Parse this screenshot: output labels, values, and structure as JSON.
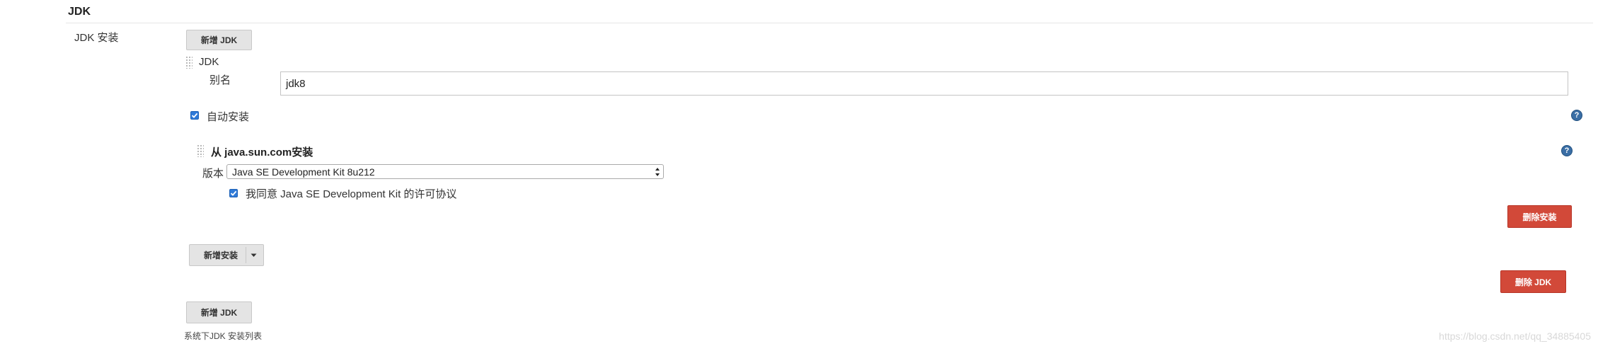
{
  "section": {
    "title": "JDK"
  },
  "jdk_install": {
    "label": "JDK 安装",
    "add_jdk_label": "新增 JDK",
    "entry": {
      "header": "JDK",
      "alias_label": "别名",
      "alias_value": "jdk8",
      "auto_install_label": "自动安装",
      "auto_install_checked": true,
      "installer": {
        "header": "从 java.sun.com安装",
        "version_label": "版本",
        "version_selected": "Java SE Development Kit 8u212",
        "license_label": "我同意 Java SE Development Kit 的许可协议",
        "license_checked": true,
        "delete_installer_label": "删除安装"
      },
      "add_installer_label": "新增安装",
      "delete_jdk_label": "删除 JDK"
    },
    "add_jdk_bottom_label": "新增 JDK",
    "description": "系统下JDK 安装列表"
  },
  "help_icon_text": "?",
  "watermark": "https://blog.csdn.net/qq_34885405",
  "colors": {
    "danger": "#d24939",
    "accent": "#2f7ad8",
    "help": "#3a6ea5"
  }
}
